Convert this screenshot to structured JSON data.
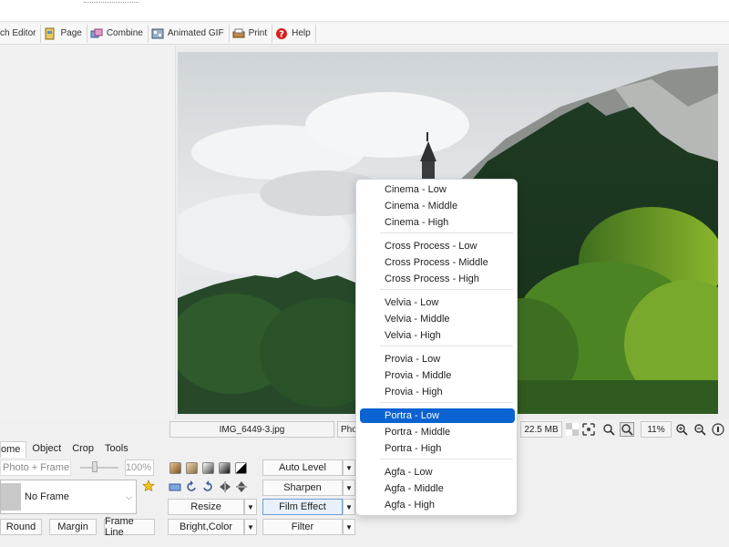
{
  "toolbar": {
    "items": [
      {
        "label": "ch Editor",
        "icon": "batch-editor-icon"
      },
      {
        "label": "Page",
        "icon": "page-icon"
      },
      {
        "label": "Combine",
        "icon": "combine-icon"
      },
      {
        "label": "Animated GIF",
        "icon": "animated-gif-icon"
      },
      {
        "label": "Print",
        "icon": "print-icon"
      },
      {
        "label": "Help",
        "icon": "help-icon"
      }
    ]
  },
  "status": {
    "filename": "IMG_6449-3.jpg",
    "partial_label": "Pho",
    "filesize": "22.5 MB",
    "zoom": "11%"
  },
  "tabs": [
    "ome",
    "Object",
    "Crop",
    "Tools"
  ],
  "tabs_active": "ome",
  "left_panel": {
    "placeholder": "Photo + Frame",
    "opacity": "100%",
    "frame": "No Frame",
    "round_label": "Round",
    "margin_label": "Margin",
    "frame_line_label": "Frame Line"
  },
  "middle": {
    "resize_label": "Resize",
    "bright_label": "Bright,Color"
  },
  "right_buttons": {
    "auto_level": "Auto Level",
    "sharpen": "Sharpen",
    "film_effect": "Film Effect",
    "filter": "Filter"
  },
  "menu": {
    "groups": [
      [
        "Cinema - Low",
        "Cinema - Middle",
        "Cinema - High"
      ],
      [
        "Cross Process - Low",
        "Cross Process - Middle",
        "Cross Process - High"
      ],
      [
        "Velvia - Low",
        "Velvia - Middle",
        "Velvia - High"
      ],
      [
        "Provia - Low",
        "Provia - Middle",
        "Provia - High"
      ],
      [
        "Portra - Low",
        "Portra - Middle",
        "Portra - High"
      ],
      [
        "Agfa - Low",
        "Agfa - Middle",
        "Agfa - High"
      ]
    ],
    "selected": "Portra - Low"
  },
  "colors": {
    "menu_selection": "#0b63d1",
    "star": "#f0c419",
    "help_red": "#d82020"
  }
}
